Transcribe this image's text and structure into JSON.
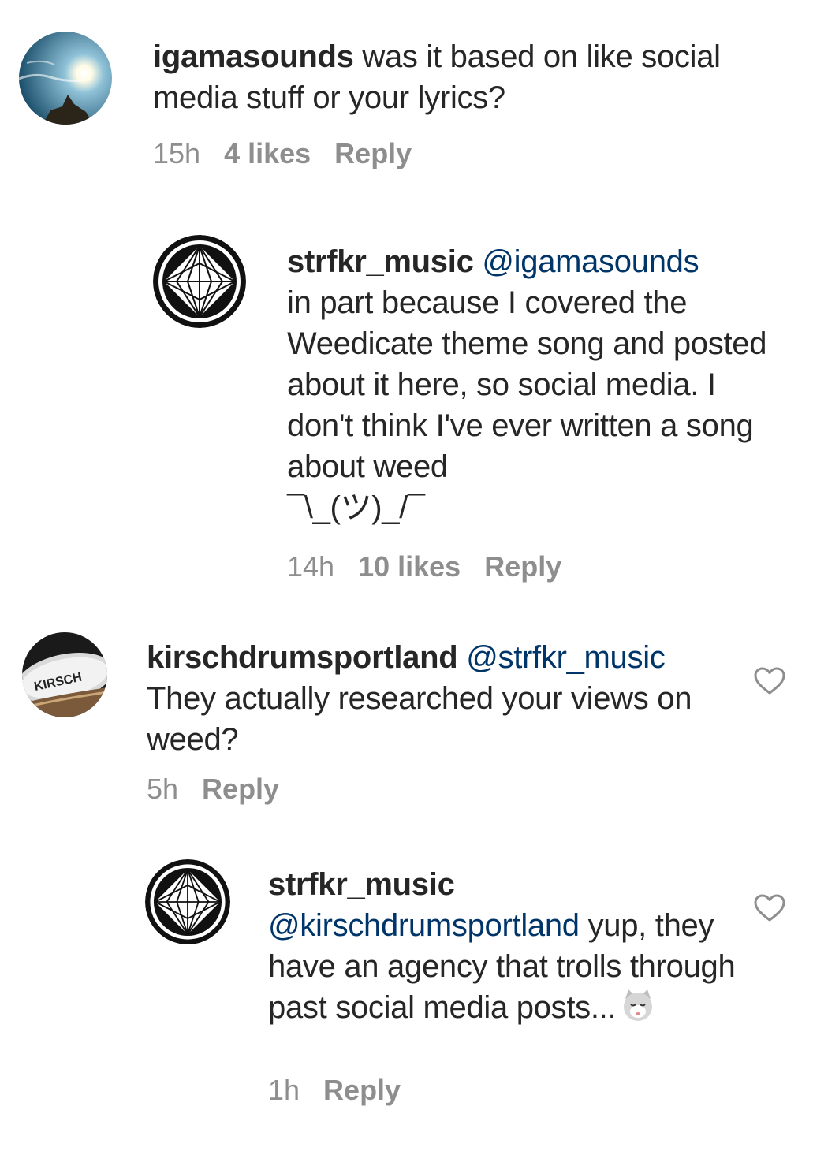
{
  "comments": [
    {
      "username": "igamasounds",
      "text": " was it based on like social media stuff or your lyrics?",
      "time": "15h",
      "likes": "4 likes",
      "reply": "Reply"
    },
    {
      "username": "strfkr_music",
      "mention": "@igamasounds",
      "text": "in part because I covered the Weedicate theme song and posted about it here, so social media. I don't think I've ever written a song about weed",
      "shrug": "¯\\_(ツ)_/¯",
      "time": "14h",
      "likes": "10 likes",
      "reply": "Reply"
    },
    {
      "username": "kirschdrumsportland",
      "mention": "@strfkr_music",
      "text": "They actually researched your views on weed?",
      "time": "5h",
      "reply": "Reply"
    },
    {
      "username": "strfkr_music",
      "mention": "@kirschdrumsportland",
      "text": " yup, they have an agency that trolls through past social media posts...",
      "time": "1h",
      "reply": "Reply"
    }
  ],
  "avatars": {
    "igamasounds": "sky-sun-avatar",
    "strfkr_music": "geometric-logo-avatar",
    "kirschdrumsportland": "kirsch-drum-avatar"
  },
  "icons": {
    "like": "heart-outline-icon",
    "emoji": "cat-face-emoji"
  },
  "colors": {
    "text": "#262626",
    "meta": "#8e8e8e",
    "mention": "#003569"
  }
}
